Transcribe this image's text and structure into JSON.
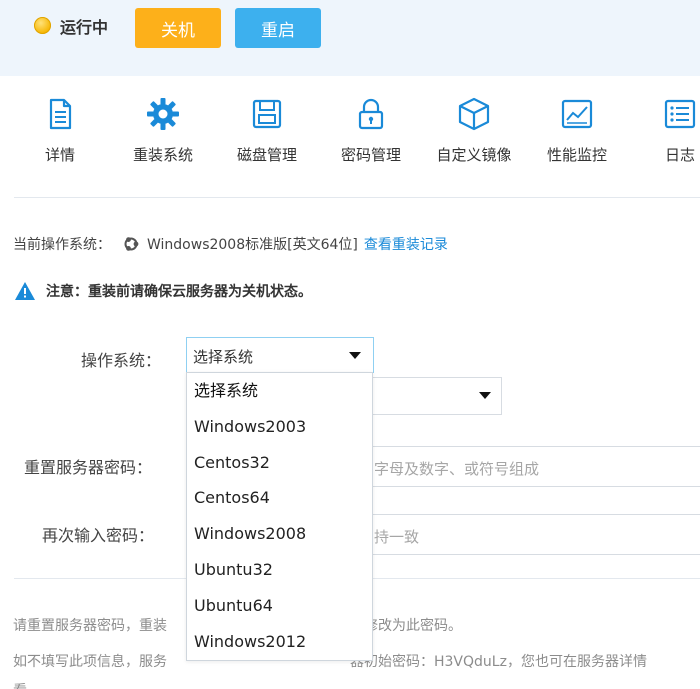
{
  "status": {
    "text": "运行中"
  },
  "buttons": {
    "shutdown": "关机",
    "restart": "重启"
  },
  "tabs": [
    {
      "label": "详情",
      "icon": "document-icon"
    },
    {
      "label": "重装系统",
      "icon": "gear-icon"
    },
    {
      "label": "磁盘管理",
      "icon": "disk-icon"
    },
    {
      "label": "密码管理",
      "icon": "lock-icon"
    },
    {
      "label": "自定义镜像",
      "icon": "cube-icon"
    },
    {
      "label": "性能监控",
      "icon": "chart-icon"
    },
    {
      "label": "日志",
      "icon": "list-icon"
    }
  ],
  "current_os": {
    "label": "当前操作系统：",
    "value": "Windows2008标准版[英文64位]",
    "link": "查看重装记录"
  },
  "notice": {
    "text": "注意：重装前请确保云服务器为关机状态。"
  },
  "form": {
    "os_label": "操作系统：",
    "os_selected": "选择系统",
    "password_label": "重置服务器密码：",
    "password_placeholder_tail": "字母及数字、或符号组成",
    "confirm_label": "再次输入密码：",
    "confirm_placeholder_tail": "持一致"
  },
  "dropdown": {
    "options": [
      "选择系统",
      "Windows2003",
      "Centos32",
      "Centos64",
      "Windows2008",
      "Ubuntu32",
      "Ubuntu64",
      "Windows2012"
    ]
  },
  "tips": {
    "line1_a": "请重置服务器密码，重装",
    "line1_b": "修改为此密码。",
    "line2_a": "如不填写此项信息，服务",
    "line2_b": "器初始密码：H3VQduLz，您也可在服务器详情",
    "line3": "看"
  },
  "colors": {
    "shutdown": "#fdb01a",
    "restart": "#3db0ee",
    "link": "#1a8ad8",
    "icon": "#1a8ad8"
  }
}
